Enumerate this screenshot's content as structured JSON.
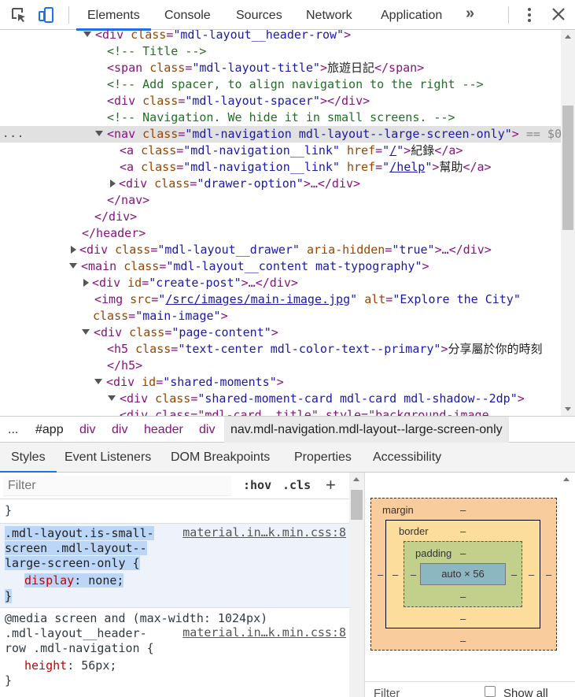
{
  "toolbar": {
    "tabs": [
      "Elements",
      "Console",
      "Sources",
      "Network",
      "Application"
    ],
    "more": "»",
    "close": "✕"
  },
  "dom": {
    "lines": {
      "l1_tag": "<div ",
      "l1_attr": "class",
      "l1_val": "\"mdl-layout__header-row\"",
      "l1_end": ">",
      "l2": "<!-- Title -->",
      "l3_tag": "<span ",
      "l3_attr": "class",
      "l3_val": "\"mdl-layout-title\"",
      "l3_txt": "旅遊日記",
      "l3_close": "</span>",
      "l4": "<!-- Add spacer, to align navigation to the right -->",
      "l5_tag": "<div ",
      "l5_attr": "class",
      "l5_val": "\"mdl-layout-spacer\"",
      "l5_close": "></div>",
      "l6": "<!-- Navigation. We hide it in small screens. -->",
      "l7_tag": "<nav ",
      "l7_attr": "class",
      "l7_val": "\"mdl-navigation mdl-layout--large-screen-only\"",
      "l7_end": ">",
      "l7_eq": " == $0",
      "l8_tag": "<a ",
      "l8_attr": "class",
      "l8_val": "\"mdl-navigation__link\"",
      "l8_href": "href",
      "l8_link": "/",
      "l8_txt": "紀錄",
      "l8_close": "</a>",
      "l9_tag": "<a ",
      "l9_attr": "class",
      "l9_val": "\"mdl-navigation__link\"",
      "l9_href": "href",
      "l9_link": "/help",
      "l9_txt": "幫助",
      "l9_close": "</a>",
      "l10_tag": "<div ",
      "l10_attr": "class",
      "l10_val": "\"drawer-option\"",
      "l10_rest": ">…</div>",
      "l11": "</nav>",
      "l12": "</div>",
      "l13": "</header>",
      "l14_tag": "<div ",
      "l14_attr": "class",
      "l14_val": "\"mdl-layout__drawer\"",
      "l14_attr2": "aria-hidden",
      "l14_val2": "\"true\"",
      "l14_rest": ">…</div>",
      "l15_tag": "<main ",
      "l15_attr": "class",
      "l15_val": "\"mdl-layout__content mat-typography\"",
      "l15_end": ">",
      "l16_tag": "<div ",
      "l16_attr": "id",
      "l16_val": "\"create-post\"",
      "l16_rest": ">…</div>",
      "l17_tag": "<img ",
      "l17_attr": "src",
      "l17_link": "/src/images/main-image.jpg",
      "l17_attr2": "alt",
      "l17_val2": "\"Explore the City\"",
      "l18_attr": "class",
      "l18_val": "\"main-image\"",
      "l18_end": ">",
      "l19_tag": "<div ",
      "l19_attr": "class",
      "l19_val": "\"page-content\"",
      "l19_end": ">",
      "l20_tag": "<h5 ",
      "l20_attr": "class",
      "l20_val": "\"text-center mdl-color-text--primary\"",
      "l20_txt": "分享屬於你的時刻",
      "l21": "</h5>",
      "l22_tag": "<div ",
      "l22_attr": "id",
      "l22_val": "\"shared-moments\"",
      "l22_end": ">",
      "l23_tag": "<div ",
      "l23_attr": "class",
      "l23_val": "\"shared-moment-card mdl-card mdl-shadow--2dp\"",
      "l23_end": ">",
      "l24": "<div class=\"mdl-card__title\" style=\"background-image"
    },
    "more_dots": "..."
  },
  "breadcrumb": {
    "ellipsis": "...",
    "items": [
      "#app",
      "div",
      "div",
      "header",
      "div"
    ],
    "current": "nav.mdl-navigation.mdl-layout--large-screen-only"
  },
  "lower_tabs": [
    "Styles",
    "Event Listeners",
    "DOM Breakpoints",
    "Properties",
    "Accessibility"
  ],
  "styles": {
    "filter_placeholder": "Filter",
    "hov": ":hov",
    "cls": ".cls",
    "plus": "+",
    "brace_close_top": "}",
    "rule1": {
      "sel1": ".mdl-layout.is-small-",
      "sel2": "screen .mdl-layout--",
      "sel3": "large-screen-only {",
      "source": "material.in…k.min.css:8",
      "prop": "display",
      "value": " none;",
      "close": "}"
    },
    "rule2": {
      "media": "@media screen and (max-width: 1024px)",
      "sel1": ".mdl-layout__header-",
      "sel2": "row .mdl-navigation {",
      "source": "material.in…k.min.css:8",
      "prop": "height",
      "value": " 56px;",
      "close": "}"
    }
  },
  "boxmodel": {
    "margin_label": "margin",
    "border_label": "border",
    "padding_label": "padding",
    "dash": "–",
    "content": "auto × 56",
    "filter_label": "Filter",
    "show_all": "Show all"
  }
}
